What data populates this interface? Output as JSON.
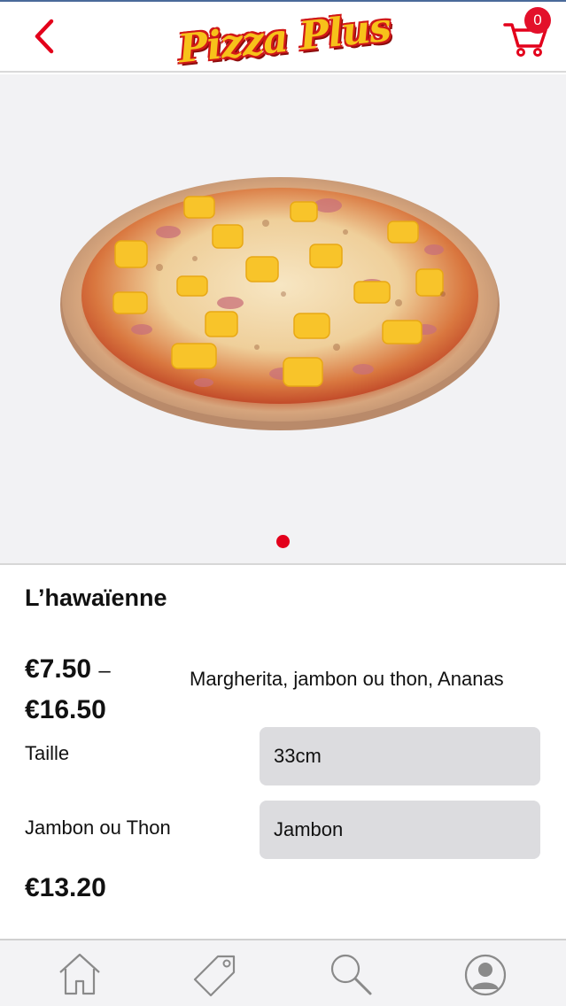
{
  "header": {
    "logo_text": "Pizza Plus",
    "cart_count": "0",
    "back_icon": "chevron-left-icon",
    "cart_icon": "shopping-cart-icon"
  },
  "hero": {
    "image": "pizza-hawaienne-photo",
    "pager_dots": 1,
    "active_dot": 0
  },
  "product": {
    "name": "L’hawaïenne",
    "price_min": "€7.50",
    "price_sep": "–",
    "price_max": "€16.50",
    "description": "Margherita, jambon ou thon, Ananas",
    "options": [
      {
        "label": "Taille",
        "value": "33cm"
      },
      {
        "label": "Jambon ou Thon",
        "value": "Jambon"
      }
    ],
    "total": "€13.20"
  },
  "tabbar": {
    "items": [
      {
        "icon": "home-icon"
      },
      {
        "icon": "tag-icon"
      },
      {
        "icon": "search-icon"
      },
      {
        "icon": "profile-icon"
      }
    ]
  },
  "colors": {
    "accent": "#e3001b",
    "logo_yellow": "#f7c21a",
    "select_bg": "#dcdcdf",
    "hero_bg": "#f2f2f4"
  }
}
